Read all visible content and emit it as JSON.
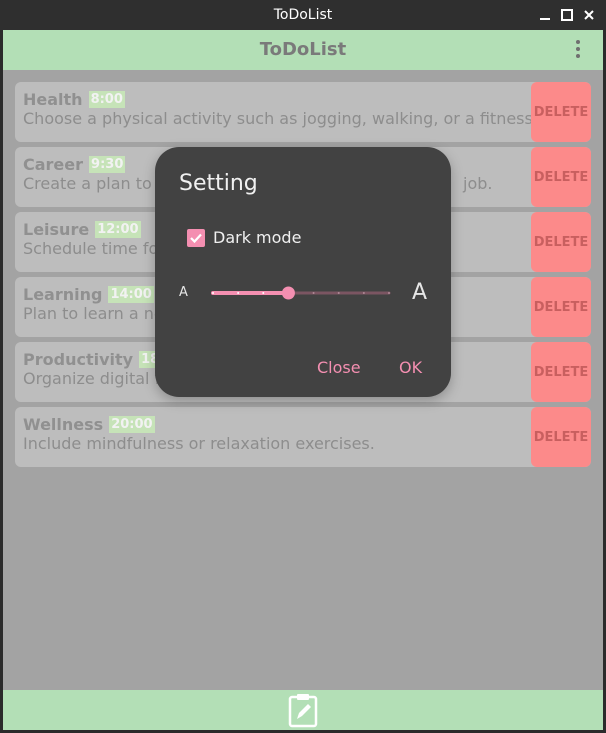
{
  "window": {
    "title": "ToDoList"
  },
  "appbar": {
    "title": "ToDoList",
    "menu_icon": "more-vert-icon"
  },
  "tasks": [
    {
      "name": "Health",
      "time": "8:00",
      "desc": "Choose a physical activity such as jogging, walking, or a fitness",
      "delete_label": "DELETE"
    },
    {
      "name": "Career",
      "time": "9:30",
      "desc": "Create a plan to u",
      "desc_tail": "job.",
      "delete_label": "DELETE"
    },
    {
      "name": "Leisure",
      "time": "12:00",
      "desc": "Schedule time for",
      "delete_label": "DELETE"
    },
    {
      "name": "Learning",
      "time": "14:00",
      "desc": "Plan to learn a ne",
      "delete_label": "DELETE"
    },
    {
      "name": "Productivity",
      "time": "18:",
      "desc": "Organize digital fi",
      "delete_label": "DELETE"
    },
    {
      "name": "Wellness",
      "time": "20:00",
      "desc": "Include mindfulness or relaxation exercises.",
      "delete_label": "DELETE"
    }
  ],
  "dialog": {
    "title": "Setting",
    "dark_mode_label": "Dark mode",
    "dark_mode_checked": true,
    "font_small_label": "A",
    "font_large_label": "A",
    "slider": {
      "steps": 8,
      "value_step": 3
    },
    "close_label": "Close",
    "ok_label": "OK"
  },
  "bottombar": {
    "icon": "edit-clipboard-icon"
  },
  "colors": {
    "accent": "#f48fb1",
    "appbar": "#b3dfb6",
    "delete": "#fc8a8a",
    "dialog_bg": "#424242",
    "time_badge": "#c6e3b8"
  }
}
